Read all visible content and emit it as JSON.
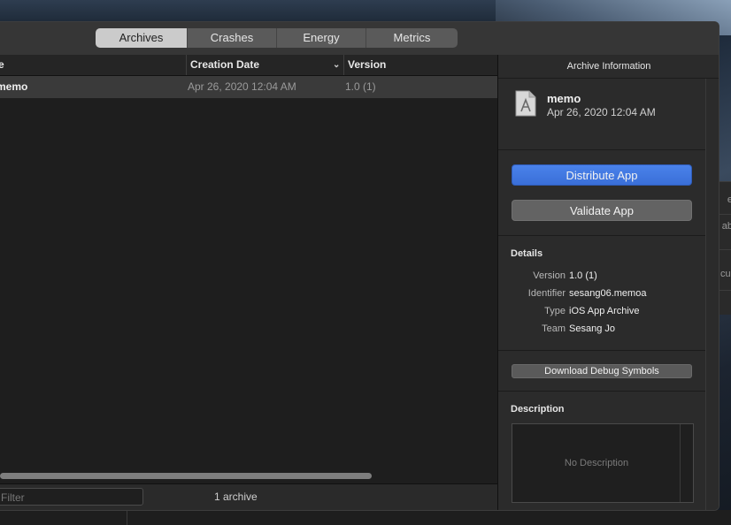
{
  "toolbar": {
    "tabs": [
      {
        "label": "Archives",
        "selected": true
      },
      {
        "label": "Crashes",
        "selected": false
      },
      {
        "label": "Energy",
        "selected": false
      },
      {
        "label": "Metrics",
        "selected": false
      }
    ]
  },
  "list": {
    "headers": {
      "name": "e",
      "creation_date": "Creation Date",
      "version": "Version"
    },
    "rows": [
      {
        "name": "memo",
        "creation_date": "Apr 26, 2020 12:04 AM",
        "version": "1.0 (1)"
      }
    ],
    "filter_placeholder": "Filter",
    "count": "1 archive"
  },
  "inspector": {
    "title": "Archive Information",
    "app_name": "memo",
    "app_date": "Apr 26, 2020 12:04 AM",
    "distribute_label": "Distribute App",
    "validate_label": "Validate App",
    "details_title": "Details",
    "details": [
      {
        "key": "Version",
        "value": "1.0 (1)"
      },
      {
        "key": "Identifier",
        "value": "sesang06.memoa"
      },
      {
        "key": "Type",
        "value": "iOS App Archive"
      },
      {
        "key": "Team",
        "value": "Sesang Jo"
      }
    ],
    "download_symbols_label": "Download Debug Symbols",
    "description_title": "Description",
    "description_placeholder": "No Description"
  },
  "background": {
    "fragments": [
      "e",
      "ab",
      "cul"
    ]
  },
  "colors": {
    "accent_blue": "#3a6fd8",
    "selected_tab": "#cbcbcb",
    "window_bg": "#1e1e1e"
  }
}
